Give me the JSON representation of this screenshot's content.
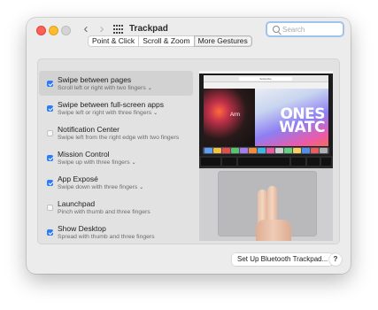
{
  "window": {
    "title": "Trackpad"
  },
  "nav": {
    "back_icon": "chevron-left-icon",
    "forward_icon": "chevron-right-icon",
    "grid_icon": "show-all-grid-icon"
  },
  "search": {
    "placeholder": "Search",
    "value": ""
  },
  "tabs": [
    {
      "label": "Point & Click",
      "selected": false
    },
    {
      "label": "Scroll & Zoom",
      "selected": false
    },
    {
      "label": "More Gestures",
      "selected": true
    }
  ],
  "gestures": [
    {
      "title": "Swipe between pages",
      "subtitle": "Scroll left or right with two fingers",
      "checked": true,
      "dropdown": true,
      "selected": true
    },
    {
      "title": "Swipe between full-screen apps",
      "subtitle": "Swipe left or right with three fingers",
      "checked": true,
      "dropdown": true,
      "selected": false
    },
    {
      "title": "Notification Center",
      "subtitle": "Swipe left from the right edge with two fingers",
      "checked": false,
      "dropdown": false,
      "selected": false
    },
    {
      "title": "Mission Control",
      "subtitle": "Swipe up with three fingers",
      "checked": true,
      "dropdown": true,
      "selected": false
    },
    {
      "title": "App Exposé",
      "subtitle": "Swipe down with three fingers",
      "checked": true,
      "dropdown": true,
      "selected": false
    },
    {
      "title": "Launchpad",
      "subtitle": "Pinch with thumb and three fingers",
      "checked": false,
      "dropdown": false,
      "selected": false
    },
    {
      "title": "Show Desktop",
      "subtitle": "Spread with thumb and three fingers",
      "checked": true,
      "dropdown": false,
      "selected": false
    }
  ],
  "preview": {
    "headline": "ONES\nWATC",
    "caption": "Arm",
    "url": "Subscribe"
  },
  "footer": {
    "bluetooth_button": "Set Up Bluetooth Trackpad...",
    "help_button": "?"
  },
  "colors": {
    "accent": "#2c7cf6",
    "close": "#fe5f57",
    "minimize": "#febc2e"
  }
}
